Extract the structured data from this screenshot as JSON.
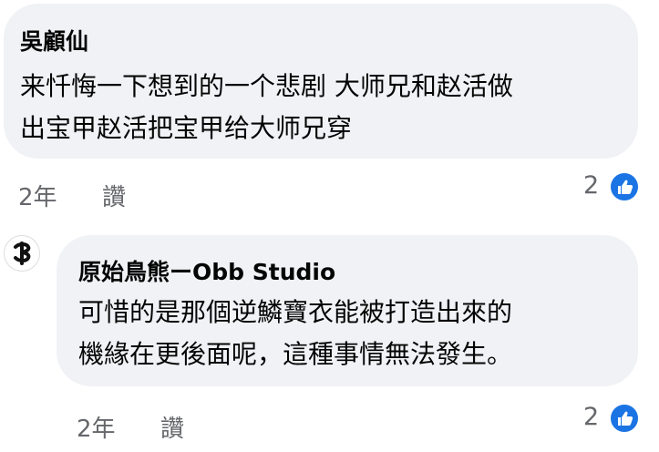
{
  "comments": [
    {
      "author": "吳顧仙",
      "lines": [
        "来忏悔一下想到的一个悲剧 大师兄和赵活做",
        "出宝甲赵活把宝甲给大师兄穿"
      ],
      "time": "2年",
      "like_label": "讚",
      "reactions": "2"
    },
    {
      "author": "原始鳥熊ーObb Studio",
      "lines": [
        "可惜的是那個逆鱗寶衣能被打造出來的",
        "機緣在更後面呢，這種事情無法發生。"
      ],
      "time": "2年",
      "like_label": "讚",
      "reactions": "2"
    }
  ],
  "colors": {
    "bubble": "#f0f2f5",
    "meta": "#65676b",
    "like": "#1b74e4"
  },
  "icons": {
    "reaction": "thumbs-up-icon",
    "avatar": "obb-studio-logo"
  }
}
